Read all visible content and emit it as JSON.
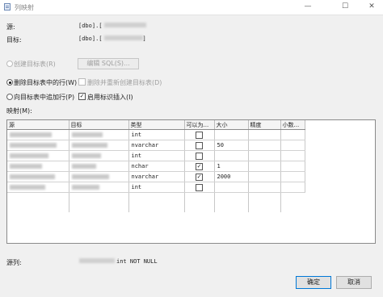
{
  "window": {
    "title": "列映射",
    "controls": {
      "minimize": "—",
      "maximize": "☐",
      "close": "✕"
    }
  },
  "source": {
    "label": "源:",
    "value": "[dbo].[",
    "close_bracket": ""
  },
  "target": {
    "label": "目标:",
    "value": "[dbo].[",
    "close_bracket": "]"
  },
  "options": {
    "create_table": {
      "label": "创建目标表(R)",
      "selected": false,
      "enabled": false
    },
    "edit_sql": {
      "label": "编辑 SQL(S)...",
      "enabled": false
    },
    "delete_rows": {
      "label": "删除目标表中的行(W)",
      "selected": true
    },
    "drop_recreate": {
      "label": "删除并重新创建目标表(D)",
      "checked": false,
      "enabled": false
    },
    "append_rows": {
      "label": "向目标表中追加行(P)",
      "selected": false
    },
    "identity_insert": {
      "label": "启用标识插入(I)",
      "checked": true
    }
  },
  "mappings": {
    "label": "映射(M):",
    "columns": [
      "源",
      "目标",
      "类型",
      "可以为...",
      "大小",
      "精度",
      "小数..."
    ],
    "rows": [
      {
        "type": "int",
        "nullable": false,
        "size": "",
        "precision": "",
        "scale": ""
      },
      {
        "type": "nvarchar",
        "nullable": false,
        "size": "50",
        "precision": "",
        "scale": ""
      },
      {
        "type": "int",
        "nullable": false,
        "size": "",
        "precision": "",
        "scale": ""
      },
      {
        "type": "nchar",
        "nullable": true,
        "size": "1",
        "precision": "",
        "scale": ""
      },
      {
        "type": "nvarchar",
        "nullable": true,
        "size": "2000",
        "precision": "",
        "scale": ""
      },
      {
        "type": "int",
        "nullable": false,
        "size": "",
        "precision": "",
        "scale": ""
      }
    ]
  },
  "source_column": {
    "label": "源列:",
    "value": "int NOT NULL"
  },
  "buttons": {
    "ok": "确定",
    "cancel": "取消"
  }
}
